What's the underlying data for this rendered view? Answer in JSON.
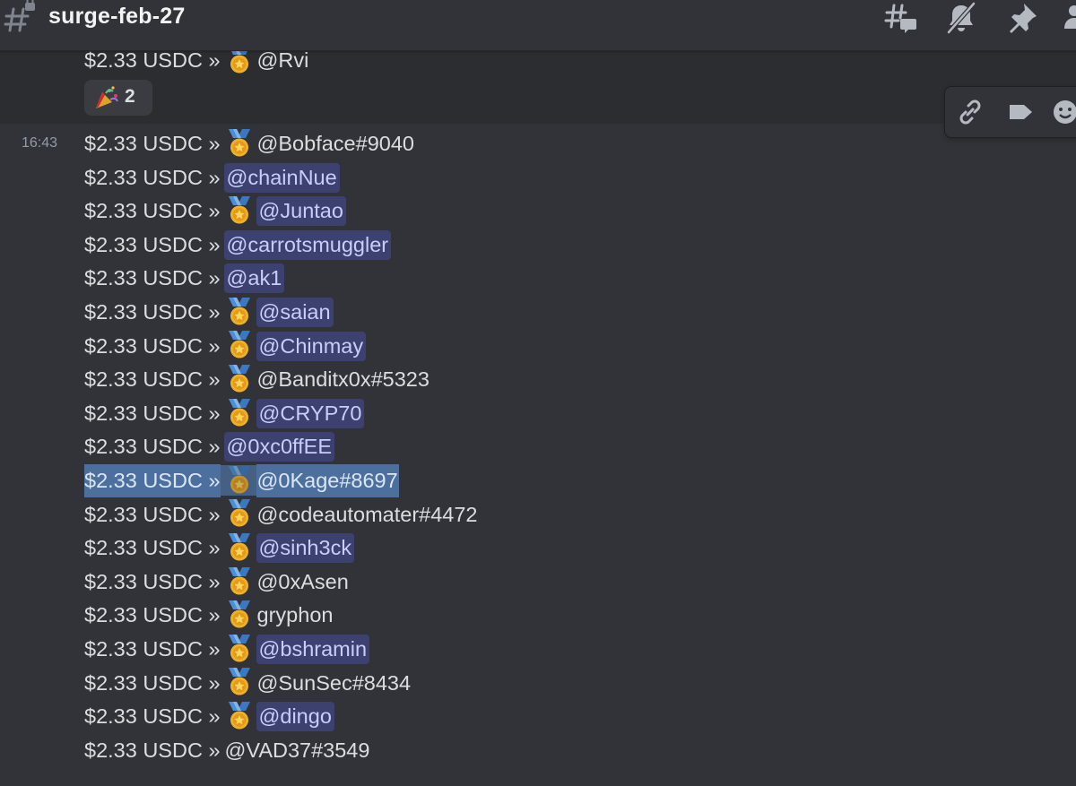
{
  "header": {
    "channel_name": "surge-feb-27",
    "icons": [
      "hash-lock-icon",
      "threads-icon",
      "mute-bell-icon",
      "pin-icon",
      "members-icon"
    ]
  },
  "previous_message": {
    "amount": "$2.33 USDC »",
    "user": "@Rvi",
    "has_medal": true,
    "reaction": {
      "emoji": "party-popper-icon",
      "count": "2"
    }
  },
  "message": {
    "timestamp": "16:43",
    "amount": "$2.33 USDC »",
    "lines": [
      {
        "user": "@Bobface#9040",
        "medal": true,
        "mention": false
      },
      {
        "user": "@chainNue",
        "medal": false,
        "mention": true
      },
      {
        "user": "@Juntao",
        "medal": true,
        "mention": true
      },
      {
        "user": "@carrotsmuggler",
        "medal": false,
        "mention": true
      },
      {
        "user": "@ak1",
        "medal": false,
        "mention": true
      },
      {
        "user": "@saian",
        "medal": true,
        "mention": true
      },
      {
        "user": "@Chinmay",
        "medal": true,
        "mention": true
      },
      {
        "user": "@Banditx0x#5323",
        "medal": true,
        "mention": false
      },
      {
        "user": "@CRYP70",
        "medal": true,
        "mention": true
      },
      {
        "user": "@0xc0ffEE",
        "medal": false,
        "mention": true
      },
      {
        "user": "@0Kage#8697",
        "medal": true,
        "mention": false,
        "selected": true
      },
      {
        "user": "@codeautomater#4472",
        "medal": true,
        "mention": false
      },
      {
        "user": "@sinh3ck",
        "medal": true,
        "mention": true
      },
      {
        "user": "@0xAsen",
        "medal": true,
        "mention": false
      },
      {
        "user": "gryphon",
        "medal": true,
        "mention": false
      },
      {
        "user": "@bshramin",
        "medal": true,
        "mention": true
      },
      {
        "user": "@SunSec#8434",
        "medal": true,
        "mention": false
      },
      {
        "user": "@dingo",
        "medal": true,
        "mention": true
      },
      {
        "user": "@VAD37#3549",
        "medal": false,
        "mention": false
      }
    ]
  },
  "toolbar": {
    "icons": [
      "link-icon",
      "tag-icon",
      "add-reaction-icon"
    ]
  },
  "colors": {
    "background": "#313338",
    "mention_bg": "#3c4270",
    "mention_text": "#c9cdfb",
    "selection": "#4d6f9e"
  }
}
